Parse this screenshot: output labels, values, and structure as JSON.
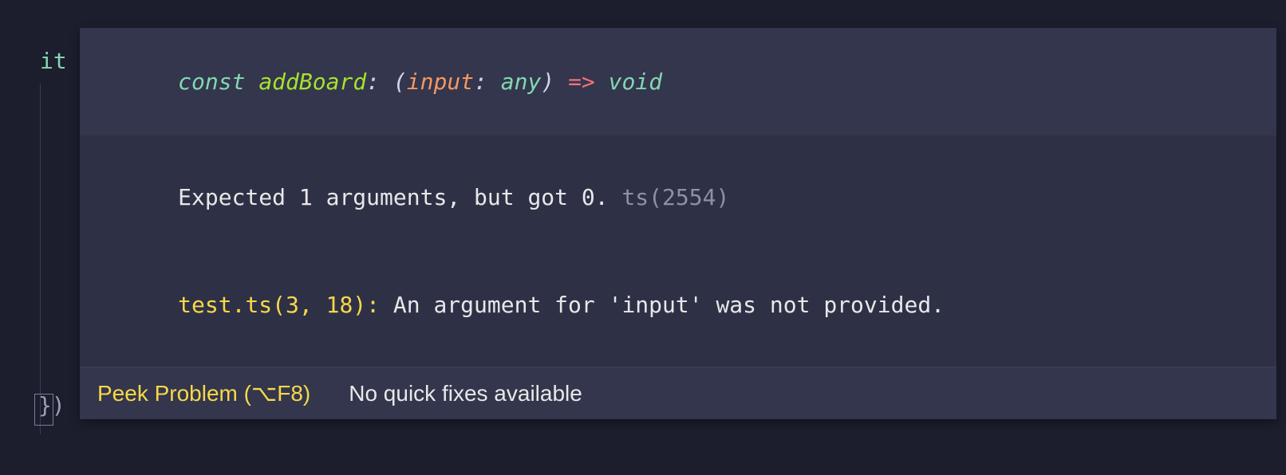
{
  "code": {
    "it_keyword": "it",
    "call_fn": "addBoard",
    "call_open": "(",
    "call_close": ")",
    "closing": "})"
  },
  "signature": {
    "keyword": "const ",
    "name": "addBoard",
    "colon1": ": ",
    "open_paren": "(",
    "param": "input",
    "param_colon": ": ",
    "param_type": "any",
    "close_paren": ") ",
    "arrow": "=> ",
    "return_type": "void"
  },
  "error": {
    "message": "Expected 1 arguments, but got 0. ",
    "code": "ts(2554)"
  },
  "location": {
    "file": "test.ts(3, 18): ",
    "message": "An argument for 'input' was not provided."
  },
  "actions": {
    "peek": "Peek Problem (⌥F8)",
    "quickfix": "No quick fixes available"
  }
}
